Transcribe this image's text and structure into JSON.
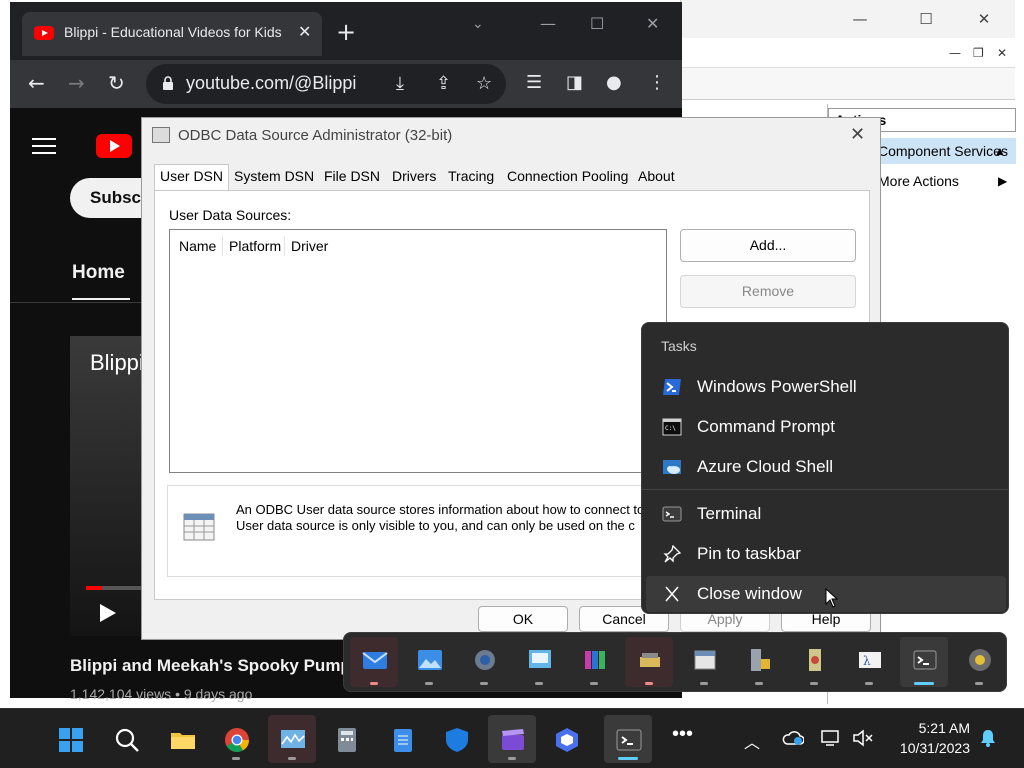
{
  "right_window": {
    "actions_header": "Actions",
    "actions_item1": "Component Services",
    "actions_item2": "More Actions"
  },
  "chrome": {
    "tab_title": "Blippi - Educational Videos for Kids",
    "url": "youtube.com/@Blippi"
  },
  "youtube": {
    "subscribe": "Subscribe",
    "home_tab": "Home",
    "video_overlay_title": "Blippi",
    "video_caption": "Blippi and Meekah's Spooky Pumpkin",
    "video_meta": "1,142,104 views • 9 days ago"
  },
  "odbc": {
    "title": "ODBC Data Source Administrator (32-bit)",
    "tabs": [
      "User DSN",
      "System DSN",
      "File DSN",
      "Drivers",
      "Tracing",
      "Connection Pooling",
      "About"
    ],
    "list_label": "User Data Sources:",
    "columns": [
      "Name",
      "Platform",
      "Driver"
    ],
    "add_button": "Add...",
    "remove_button": "Remove",
    "info_line1": "An ODBC User data source stores information about how to connect to",
    "info_line2": "User data source is only visible to you, and can only be used on the c",
    "ok_button": "OK",
    "cancel_button": "Cancel",
    "apply_button": "Apply",
    "help_button": "Help"
  },
  "jumplist": {
    "header": "Tasks",
    "items": [
      {
        "label": "Windows PowerShell",
        "icon": "powershell-icon"
      },
      {
        "label": "Command Prompt",
        "icon": "command-prompt-icon"
      },
      {
        "label": "Azure Cloud Shell",
        "icon": "azure-cloud-icon"
      },
      {
        "label": "Terminal",
        "icon": "terminal-icon"
      },
      {
        "label": "Pin to taskbar",
        "icon": "pin-icon"
      },
      {
        "label": "Close window",
        "icon": "close-icon"
      }
    ]
  },
  "taskbar": {
    "time": "5:21 AM",
    "date": "10/31/2023"
  },
  "colors": {
    "accent": "#60cdff",
    "youtube_red": "#ff0000",
    "popup_bg": "#2b2b2b",
    "taskbar_bg": "#202020"
  }
}
